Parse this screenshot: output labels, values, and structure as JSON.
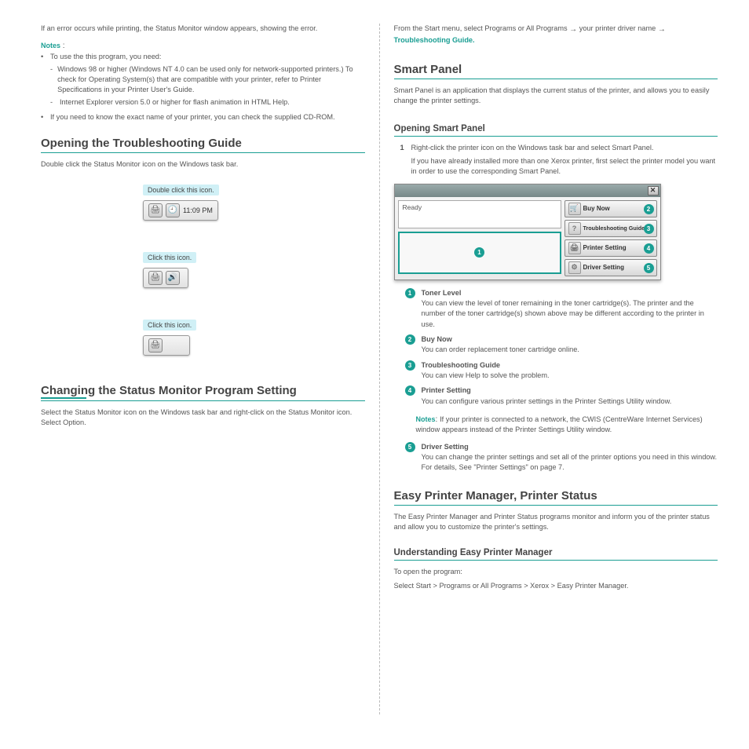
{
  "left": {
    "intro": "If an error occurs while printing, the Status Monitor window appears, showing the error.",
    "note_label": "Notes",
    "notes": [
      "To use the this program, you need:",
      "Windows 98 or higher (Windows NT 4.0 can be used only for network-supported printers.) To check for Operating System(s) that are compatible with your printer, refer to Printer Specifications in your Printer User's Guide.",
      "Internet Explorer version 5.0 or higher for flash animation in HTML Help."
    ],
    "note2": "If you need to know the exact name of your printer, you can check the supplied CD-ROM.",
    "section1_title": "Opening the Troubleshooting Guide",
    "section1_text": "Double click the Status Monitor icon on the Windows task bar.",
    "section1_callout": "Double click this icon.",
    "tray_time": "11:09 PM",
    "tray_click": "Click this icon.",
    "tray_click2": "Click this icon.",
    "section2_title": "Changing the Status Monitor Program Setting",
    "section2_text": "Select the Status Monitor icon on the Windows task bar and right-click on the Status Monitor icon. Select Option."
  },
  "right": {
    "opt_intro1": "From the Start menu, select Programs or All Programs",
    "arrow1": "→",
    "opt_intro2": " your printer driver name ",
    "arrow2": "→",
    "opt_intro3": "Troubleshooting Guide.",
    "h1": "Smart Panel",
    "h1_text": "Smart Panel is an application that displays the current status of the printer, and allows you to easily change the printer settings.",
    "h2": "Opening Smart Panel",
    "h2_text1": "Right-click the printer icon on the Windows task bar and select Smart Panel.",
    "h2_text2": "If you have already installed more than one Xerox printer, first select the printer model you want in order to use the corresponding Smart Panel.",
    "sm_status": "Ready",
    "sm_buy": "Buy Now",
    "sm_tg": "Troubleshooting Guide",
    "sm_ps": "Printer Setting",
    "sm_ds": "Driver Setting",
    "legend": [
      {
        "n": "1",
        "title": "Toner Level",
        "text": "You can view the level of toner remaining in the toner cartridge(s). The printer and the number of the toner cartridge(s) shown above may be different according to the printer in use."
      },
      {
        "n": "2",
        "title": "Buy Now",
        "text": "You can order replacement toner cartridge online."
      },
      {
        "n": "3",
        "title": "Troubleshooting Guide",
        "text": "You can view Help to solve the problem."
      },
      {
        "n": "4",
        "title": "Printer Setting",
        "text": "You can configure various printer settings in the Printer Settings Utility window."
      }
    ],
    "note_label": "Notes",
    "note_text": "If your printer is connected to a network, the CWIS (CentreWare Internet Services) window appears instead of the Printer Settings Utility window.",
    "legend5_title": "Driver Setting",
    "legend5_text": "You can change the printer settings and set all of the printer options you need in this window. For details, See \"Printer Settings\" on page 7.",
    "h3": "Easy Printer Manager, Printer Status",
    "h3_text": "The Easy Printer Manager and Printer Status programs monitor and inform you of the printer status and allow you to customize the printer's settings.",
    "h4": "Understanding Easy Printer Manager",
    "h4_text1": "To open the program:",
    "h4_text2": "Select Start > Programs or All Programs > Xerox > Easy Printer Manager."
  }
}
